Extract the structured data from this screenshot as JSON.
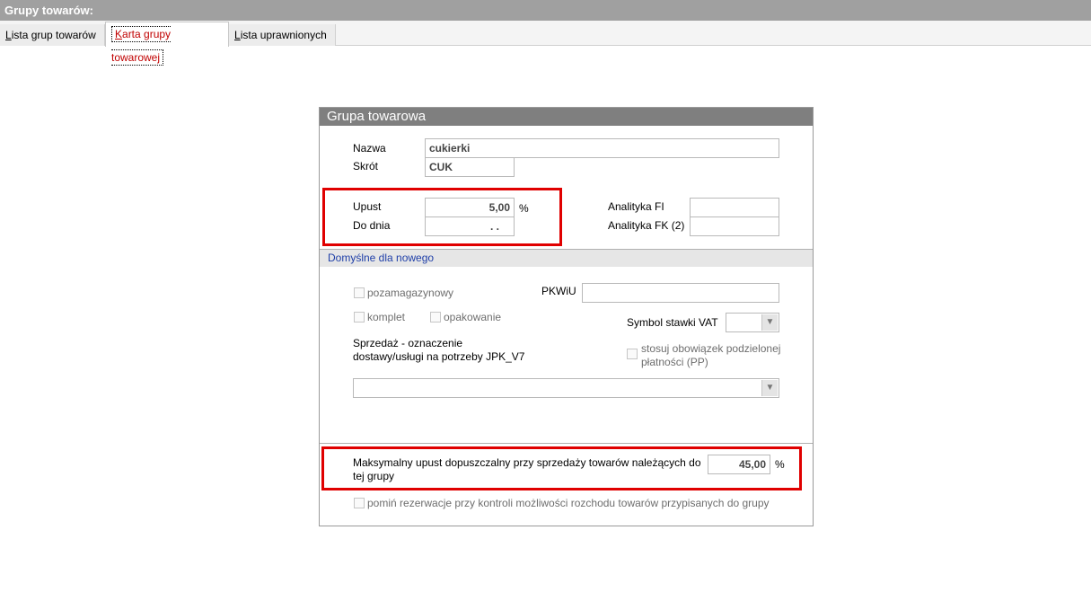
{
  "window": {
    "title": "Grupy towarów:"
  },
  "tabs": [
    {
      "label_first": "L",
      "label_rest": "ista grup towarów"
    },
    {
      "label_first": "K",
      "label_rest": "arta grupy towarowej"
    },
    {
      "label_first": "L",
      "label_rest": "ista uprawnionych"
    }
  ],
  "panel": {
    "title": "Grupa towarowa",
    "nazwa_label": "Nazwa",
    "nazwa_value": "cukierki",
    "skrot_label": "Skrót",
    "skrot_value": "CUK",
    "upust_label": "Upust",
    "upust_value": "5,00",
    "upust_unit": "%",
    "dodnia_label": "Do dnia",
    "dodnia_value": ". .",
    "analityka_fi_label": "Analityka FI",
    "analityka_fi_value": "",
    "analityka_fk_label": "Analityka FK (2)",
    "analityka_fk_value": ""
  },
  "defaults": {
    "section_title": "Domyślne dla nowego",
    "pozamagazynowy_label": "pozamagazynowy",
    "komplet_label": "komplet",
    "opakowanie_label": "opakowanie",
    "pkwiu_label": "PKWiU",
    "pkwiu_value": "",
    "vat_label": "Symbol stawki VAT",
    "vat_value": "",
    "sprzedaz_label_line1": "Sprzedaż - oznaczenie",
    "sprzedaz_label_line2": "dostawy/usługi  na potrzeby JPK_V7",
    "sprzedaz_value": "",
    "pp_label_line1": "stosuj obowiązek podzielonej",
    "pp_label_line2": "płatności (PP)"
  },
  "max_discount": {
    "label_line1": "Maksymalny upust  dopuszczalny przy sprzedaży towarów należących do",
    "label_line2": "tej grupy",
    "value": "45,00",
    "unit": "%"
  },
  "reservation": {
    "label": "pomiń rezerwacje przy kontroli możliwości rozchodu towarów przypisanych do grupy"
  },
  "colors": {
    "highlight": "#e00000",
    "header_bg": "#7f7f7f",
    "active_tab_text": "#c00000"
  }
}
